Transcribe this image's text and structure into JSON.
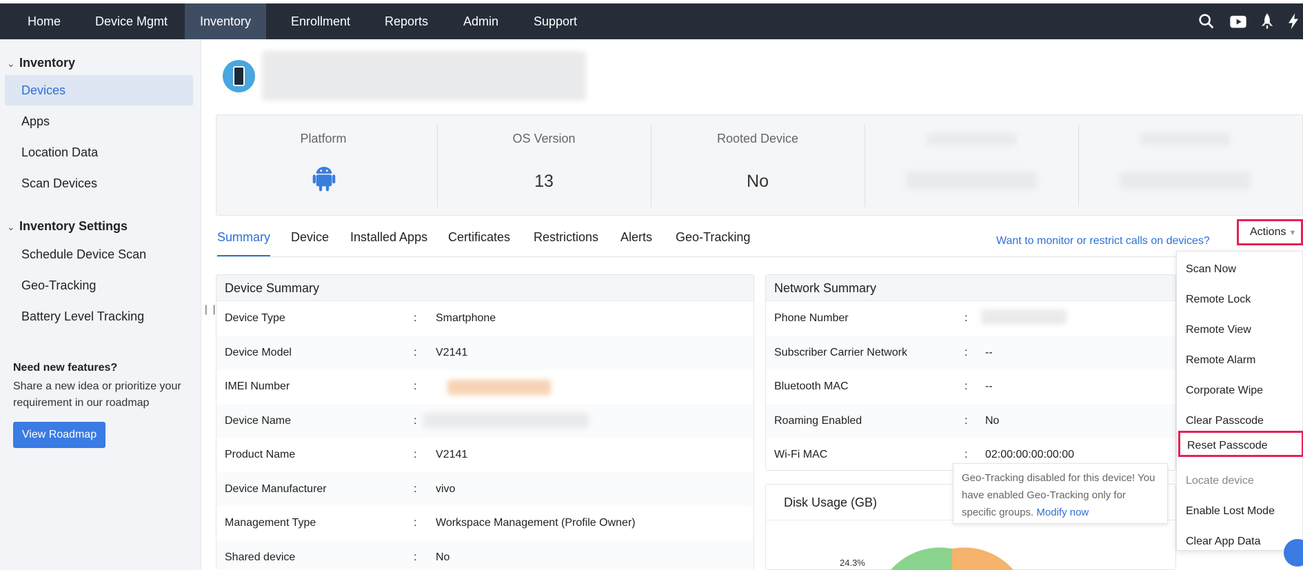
{
  "nav": {
    "items": [
      "Home",
      "Device Mgmt",
      "Inventory",
      "Enrollment",
      "Reports",
      "Admin",
      "Support"
    ],
    "active": "Inventory",
    "icons": [
      "search-icon",
      "youtube-icon",
      "rocket-icon",
      "flash-icon"
    ]
  },
  "sidebar": {
    "inventory_title": "Inventory",
    "inventory_items": [
      "Devices",
      "Apps",
      "Location Data",
      "Scan Devices"
    ],
    "settings_title": "Inventory Settings",
    "settings_items": [
      "Schedule Device Scan",
      "Geo-Tracking",
      "Battery Level Tracking"
    ],
    "promo_title": "Need new features?",
    "promo_text": "Share a new idea or prioritize your requirement in our roadmap",
    "promo_button": "View Roadmap"
  },
  "stats": [
    {
      "label": "Platform",
      "value_icon": "android-icon"
    },
    {
      "label": "OS Version",
      "value": "13"
    },
    {
      "label": "Rooted Device",
      "value": "No"
    }
  ],
  "tabs": [
    "Summary",
    "Device",
    "Installed Apps",
    "Certificates",
    "Restrictions",
    "Alerts",
    "Geo-Tracking"
  ],
  "active_tab": "Summary",
  "promo_link": "Want to monitor or restrict calls on devices?",
  "actions_label": "Actions",
  "device_summary": {
    "title": "Device Summary",
    "rows": [
      {
        "key": "Device Type",
        "value": "Smartphone"
      },
      {
        "key": "Device Model",
        "value": "V2141"
      },
      {
        "key": "IMEI Number",
        "value": ""
      },
      {
        "key": "Device Name",
        "value": ""
      },
      {
        "key": "Product Name",
        "value": "V2141"
      },
      {
        "key": "Device Manufacturer",
        "value": "vivo"
      },
      {
        "key": "Management Type",
        "value": "Workspace Management (Profile Owner)"
      },
      {
        "key": "Shared device",
        "value": "No"
      }
    ]
  },
  "network_summary": {
    "title": "Network Summary",
    "rows": [
      {
        "key": "Phone Number",
        "value": ""
      },
      {
        "key": "Subscriber Carrier Network",
        "value": "--"
      },
      {
        "key": "Bluetooth MAC",
        "value": "--"
      },
      {
        "key": "Roaming Enabled",
        "value": "No"
      },
      {
        "key": "Wi-Fi MAC",
        "value": "02:00:00:00:00:00"
      }
    ]
  },
  "disk_usage": {
    "title": "Disk Usage (GB)",
    "slice_label": "24.3%"
  },
  "actions_menu": [
    "Scan Now",
    "Remote Lock",
    "Remote View",
    "Remote Alarm",
    "Corporate Wipe",
    "Clear Passcode",
    "Reset Passcode",
    "Locate device",
    "Enable Lost Mode",
    "Clear App Data"
  ],
  "actions_disabled": [
    "Locate device"
  ],
  "actions_highlighted": "Reset Passcode",
  "tooltip": {
    "text": "Geo-Tracking disabled for this device! You have enabled Geo-Tracking only for specific groups.",
    "link": "Modify now"
  },
  "separator": ":",
  "colors": {
    "accent": "#2d6fd6",
    "nav_bg": "#262d39",
    "highlight": "#e32355",
    "disk_green": "#8ad38d",
    "disk_orange": "#f5b36b"
  }
}
